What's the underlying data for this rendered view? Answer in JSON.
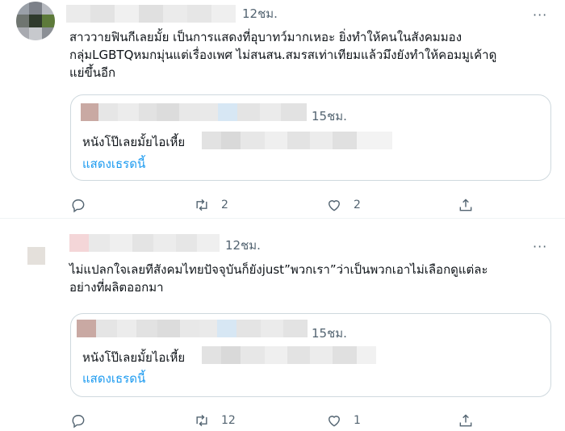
{
  "tweets": [
    {
      "time": "12ชม.",
      "text": "สาววายฟินกีเลยมั้ย เป็นการแสดงที่อุบาทว์มากเหอะ ยิ่งทำให้คนในสังคมมอง\nกลุ่มLGBTQหมกมุ่นแต่เรื่องเพศ ไม่สนสน.สมรสเท่าเทียมแล้วมึงยังทำให้คอมมูเค้าดู\nแย่ขึ้นอีก",
      "quote": {
        "time": "15ชม.",
        "text": "หนังโป๊เลยมั้ยไอเหี้ย",
        "link": "แสดงเธรดนี้"
      },
      "actions": {
        "reply": "",
        "retweet": "2",
        "like": "2",
        "share": ""
      }
    },
    {
      "time": "12ชม.",
      "text": "ไม่แปลกใจเลยทีสังคมไทยปัจจุบันก็ยังjust”พวกเรา”ว่าเป็นพวกเอาไม่เลือกดูแต่ละ\nอย่างที่ผลิตออกมา",
      "quote": {
        "time": "15ชม.",
        "text": "หนังโป๊เลยมั้ยไอเหี้ย",
        "link": "แสดงเธรดนี้"
      },
      "actions": {
        "reply": "",
        "retweet": "12",
        "like": "1",
        "share": ""
      }
    }
  ],
  "more_label": "···",
  "icons": {
    "reply": "reply-icon",
    "retweet": "retweet-icon",
    "like": "like-icon",
    "share": "share-icon",
    "more": "more-icon"
  },
  "colors": {
    "link": "#1d9bf0",
    "muted": "#536471",
    "border": "#cfd9de"
  }
}
